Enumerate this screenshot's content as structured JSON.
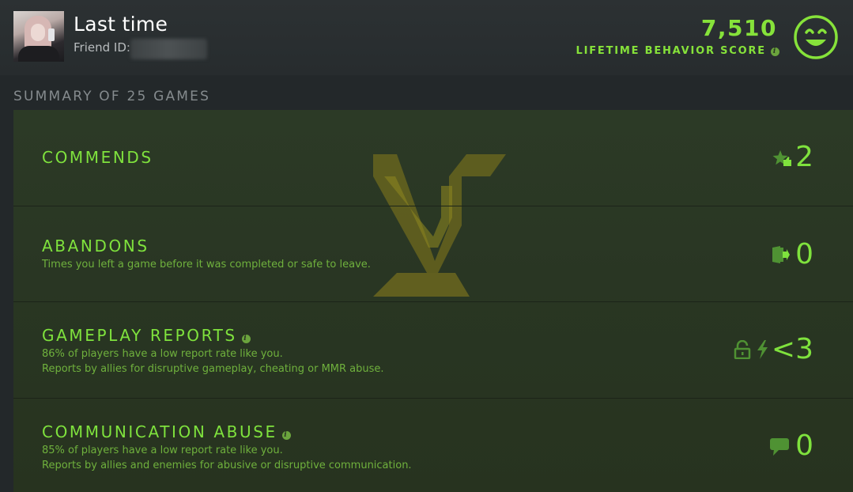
{
  "header": {
    "name": "Last time",
    "friend_id_label": "Friend ID:",
    "score": "7,510",
    "score_label": "LIFETIME BEHAVIOR SCORE"
  },
  "summary": {
    "title": "SUMMARY OF 25 GAMES",
    "rows": [
      {
        "title": "COMMENDS",
        "desc1": "",
        "desc2": "",
        "value": "2",
        "icon": "star-thumb-icon"
      },
      {
        "title": "ABANDONS",
        "desc1": "Times you left a game before it was completed or safe to leave.",
        "desc2": "",
        "value": "0",
        "icon": "exit-door-icon"
      },
      {
        "title": "GAMEPLAY REPORTS",
        "desc1": "86% of players have a low report rate like you.",
        "desc2": "Reports by allies for disruptive gameplay, cheating or MMR abuse.",
        "value": "<3",
        "icon": "lock-icon"
      },
      {
        "title": "COMMUNICATION ABUSE",
        "desc1": "85% of players have a low report rate like you.",
        "desc2": "Reports by allies and enemies for abusive or disruptive communication.",
        "value": "0",
        "icon": "chat-bubble-icon"
      }
    ]
  },
  "colors": {
    "accent": "#7fe23d",
    "background": "#23282a",
    "panel": "#2a3724"
  }
}
